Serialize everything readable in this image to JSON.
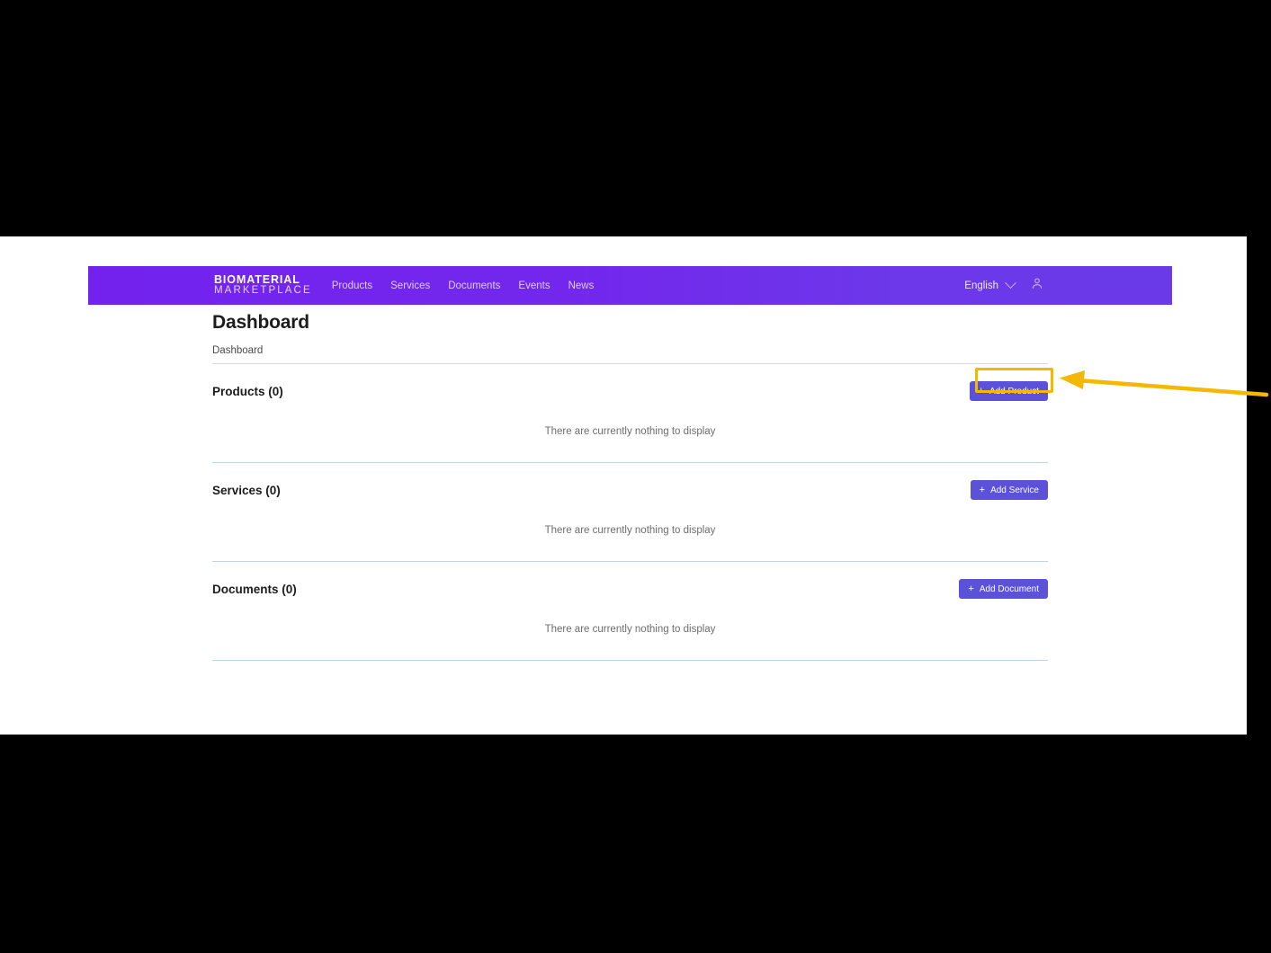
{
  "header": {
    "brand_line1": "BIOMATERIAL",
    "brand_line2": "MARKETPLACE",
    "nav": [
      {
        "label": "Products"
      },
      {
        "label": "Services"
      },
      {
        "label": "Documents"
      },
      {
        "label": "Events"
      },
      {
        "label": "News"
      }
    ],
    "language": "English",
    "account_icon": "user-icon",
    "chevron_icon": "chevron-down-icon",
    "background_color": "#7322ee"
  },
  "page": {
    "title": "Dashboard",
    "breadcrumb": "Dashboard"
  },
  "sections": [
    {
      "title": "Products (0)",
      "count": 0,
      "button_label": "Add Product",
      "button_icon": "plus-icon",
      "empty_message": "There are currently nothing to display",
      "highlighted": true
    },
    {
      "title": "Services (0)",
      "count": 0,
      "button_label": "Add Service",
      "button_icon": "plus-icon",
      "empty_message": "There are currently nothing to display",
      "highlighted": false
    },
    {
      "title": "Documents (0)",
      "count": 0,
      "button_label": "Add Document",
      "button_icon": "plus-icon",
      "empty_message": "There are currently nothing to display",
      "highlighted": false
    }
  ],
  "annotation": {
    "highlight_color": "#f5b800",
    "arrow_color": "#f5b800",
    "arrow_direction": "left",
    "points_to": "Add Product"
  },
  "theme": {
    "button_color": "#5b52d9",
    "divider_color": "#bcd6e3",
    "letterbox_color": "#000000"
  }
}
